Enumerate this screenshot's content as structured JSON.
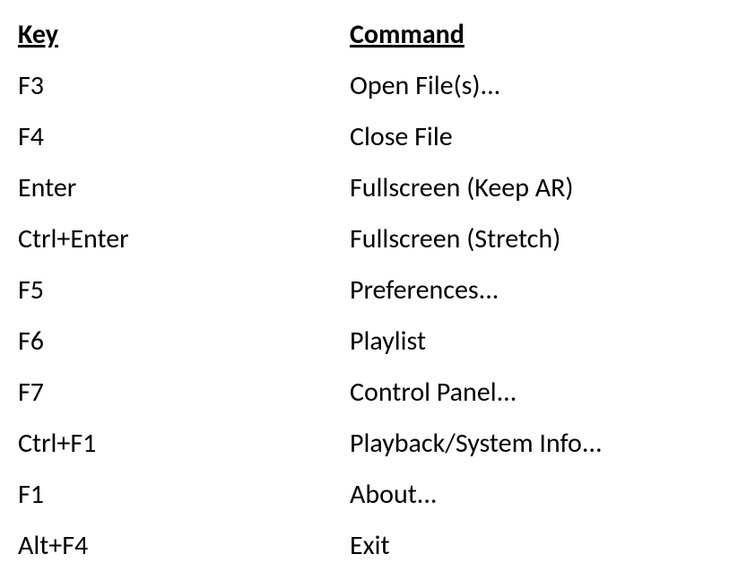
{
  "headers": {
    "key": "Key",
    "command": "Command"
  },
  "rows": [
    {
      "key": "F3",
      "command": "Open File(s)..."
    },
    {
      "key": "F4",
      "command": "Close File"
    },
    {
      "key": "Enter",
      "command": "Fullscreen (Keep AR)"
    },
    {
      "key": "Ctrl+Enter",
      "command": "Fullscreen (Stretch)"
    },
    {
      "key": "F5",
      "command": "Preferences..."
    },
    {
      "key": "F6",
      "command": "Playlist"
    },
    {
      "key": "F7",
      "command": "Control Panel..."
    },
    {
      "key": "Ctrl+F1",
      "command": "Playback/System Info..."
    },
    {
      "key": "F1",
      "command": "About..."
    },
    {
      "key": "Alt+F4",
      "command": "Exit"
    }
  ]
}
